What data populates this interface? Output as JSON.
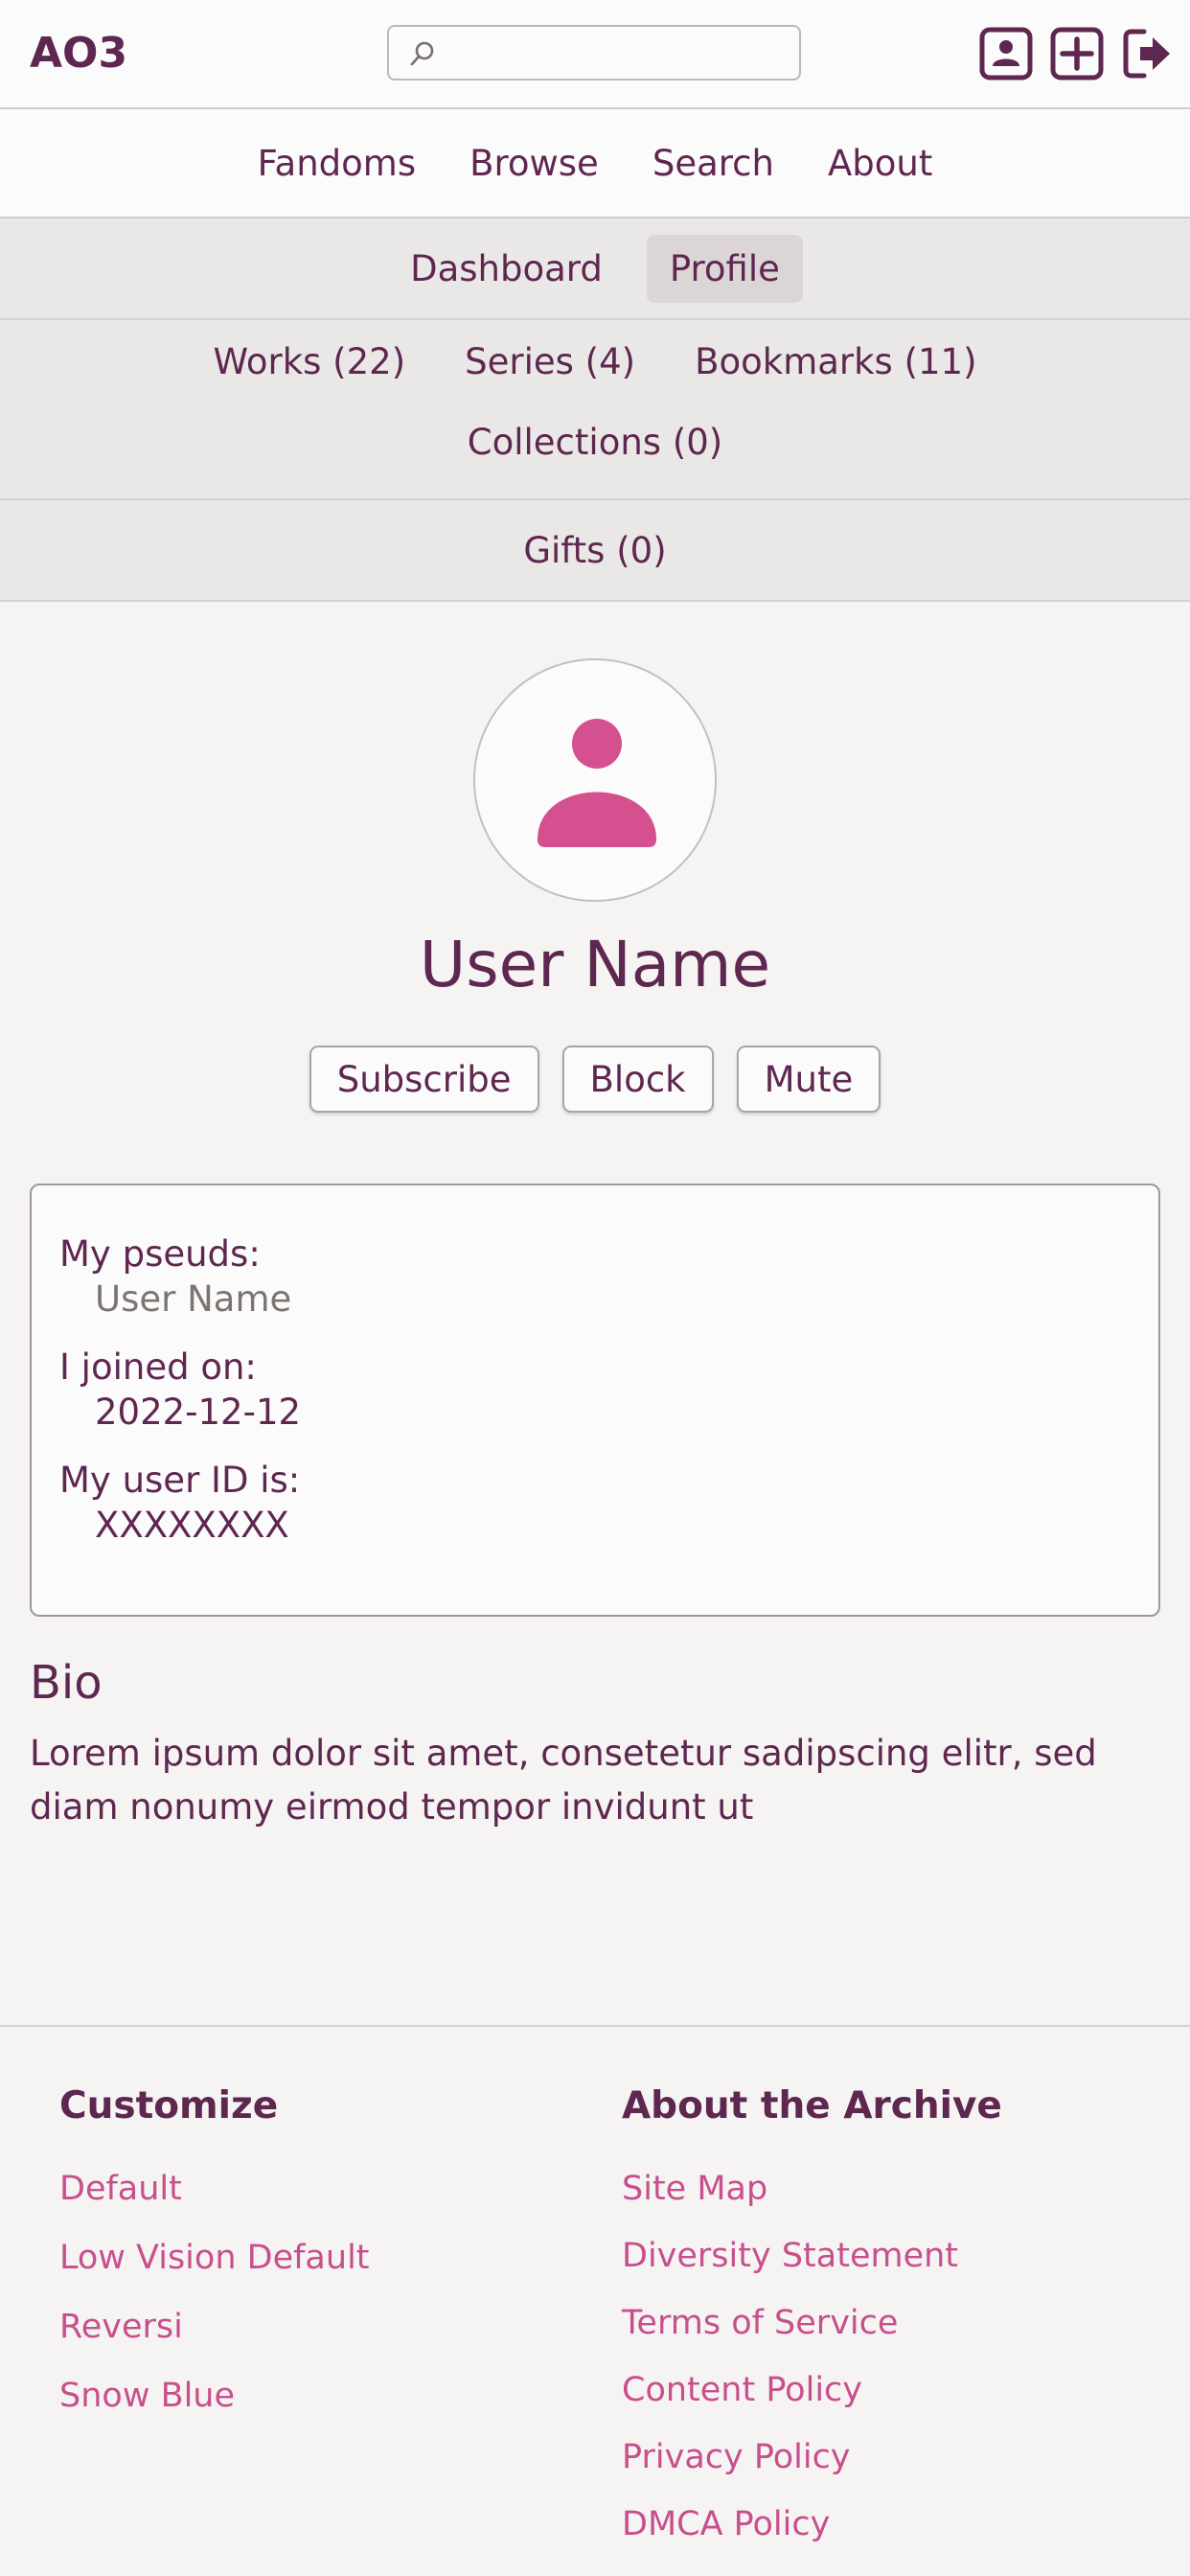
{
  "header": {
    "logo": "AO3",
    "search_placeholder": "",
    "icons": [
      "profile-icon",
      "new-work-icon",
      "logout-icon"
    ]
  },
  "main_nav": [
    "Fandoms",
    "Browse",
    "Search",
    "About"
  ],
  "sub_nav": {
    "dashboard": "Dashboard",
    "profile": "Profile"
  },
  "works_nav": {
    "works": "Works (22)",
    "series": "Series (4)",
    "bookmarks": "Bookmarks (11)",
    "collections": "Collections (0)"
  },
  "gifts_label": "Gifts (0)",
  "profile": {
    "user_name": "User Name",
    "buttons": {
      "subscribe": "Subscribe",
      "block": "Block",
      "mute": "Mute"
    },
    "pseuds_label": "My pseuds:",
    "pseuds_value": "User Name",
    "joined_label": "I joined on:",
    "joined_value": "2022-12-12",
    "user_id_label": "My user ID is:",
    "user_id_value": "XXXXXXXX"
  },
  "bio": {
    "title": "Bio",
    "text": "Lorem ipsum dolor sit amet, consetetur sadipscing elitr, sed diam nonumy eirmod tempor invidunt ut"
  },
  "footer": {
    "customize": {
      "title": "Customize",
      "links": [
        "Default",
        "Low Vision Default",
        "Reversi",
        "Snow Blue"
      ]
    },
    "about": {
      "title": "About the Archive",
      "links": [
        "Site Map",
        "Diversity Statement",
        "Terms of Service",
        "Content Policy",
        "Privacy Policy",
        "DMCA Policy"
      ]
    }
  },
  "colors": {
    "brand": "#5e2750",
    "link": "#c84f8d",
    "avatar": "#d4508f"
  }
}
